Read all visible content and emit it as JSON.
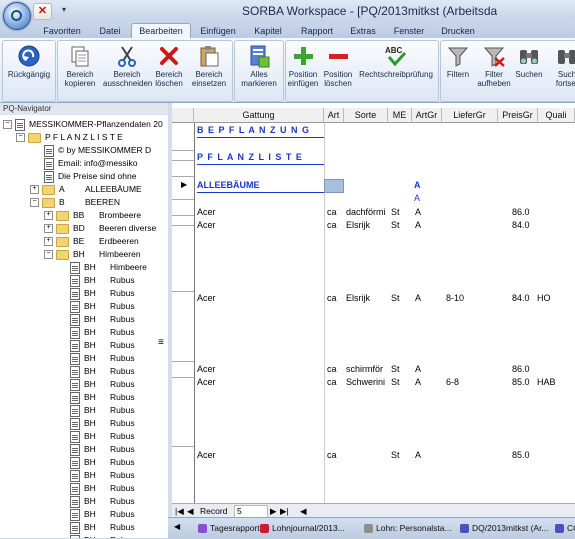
{
  "window": {
    "title": "SORBA Workspace - [PQ/2013mitkst (Arbeitsda",
    "close_glyph": "✕",
    "dropdown_glyph": "▾"
  },
  "tabs": [
    {
      "label": "Favoriten",
      "active": false
    },
    {
      "label": "Datei",
      "active": false
    },
    {
      "label": "Bearbeiten",
      "active": true
    },
    {
      "label": "Einfügen",
      "active": false
    },
    {
      "label": "Kapitel",
      "active": false
    },
    {
      "label": "Rapport",
      "active": false
    },
    {
      "label": "Extras",
      "active": false
    },
    {
      "label": "Fenster",
      "active": false
    },
    {
      "label": "Drucken",
      "active": false
    }
  ],
  "ribbon": {
    "undo": {
      "line1": "Rückgängig",
      "line2": "",
      "icon": "undo-icon"
    },
    "copy": {
      "line1": "Bereich",
      "line2": "kopieren",
      "icon": "copy-icon"
    },
    "cut": {
      "line1": "Bereich",
      "line2": "ausschneiden",
      "icon": "scissors-icon"
    },
    "delete": {
      "line1": "Bereich",
      "line2": "löschen",
      "icon": "delete-x-icon"
    },
    "paste": {
      "line1": "Bereich",
      "line2": "einsetzen",
      "icon": "paste-icon"
    },
    "select_all": {
      "line1": "Alles",
      "line2": "markieren",
      "icon": "select-all-icon"
    },
    "insert_pos": {
      "line1": "Position",
      "line2": "einfügen",
      "icon": "plus-icon"
    },
    "delete_pos": {
      "line1": "Position",
      "line2": "löschen",
      "icon": "minus-icon"
    },
    "spellcheck": {
      "line1": "Rechtschreibprüfung",
      "line2": "",
      "icon": "spellcheck-icon",
      "icon_text": "ABC"
    },
    "filter": {
      "line1": "Filtern",
      "line2": "",
      "icon": "funnel-icon"
    },
    "filter_off": {
      "line1": "Filter",
      "line2": "aufheben",
      "icon": "funnel-remove-icon"
    },
    "search": {
      "line1": "Suchen",
      "line2": "",
      "icon": "binoculars-icon"
    },
    "search_next": {
      "line1": "Such",
      "line2": "fortset",
      "icon": "binoculars-next-icon"
    }
  },
  "navigator": {
    "title": "PQ-Navigator",
    "root_label": "MESSIKOMMER-Pflanzendaten 20",
    "items": [
      {
        "type": "folder",
        "exp": "-",
        "code": "",
        "label": "P F L A N Z L I S T E"
      },
      {
        "type": "doc",
        "code": "",
        "label": "© by  MESSIKOMMER D"
      },
      {
        "type": "doc",
        "code": "",
        "label": "Email: info@messiko"
      },
      {
        "type": "doc",
        "code": "",
        "label": "Die Preise sind ohne"
      },
      {
        "type": "folder",
        "exp": "+",
        "code": "A",
        "label": "ALLEEBÄUME"
      },
      {
        "type": "folder",
        "exp": "-",
        "code": "B",
        "label": "BEEREN"
      },
      {
        "type": "folder",
        "exp": "+",
        "code": "BB",
        "label": "Brombeere"
      },
      {
        "type": "folder",
        "exp": "+",
        "code": "BD",
        "label": "Beeren diverse"
      },
      {
        "type": "folder",
        "exp": "+",
        "code": "BE",
        "label": "Erdbeeren"
      },
      {
        "type": "folder",
        "exp": "-",
        "code": "BH",
        "label": "Himbeeren"
      },
      {
        "type": "doc",
        "code": "BH",
        "label": "Himbeere"
      },
      {
        "type": "doc",
        "code": "BH",
        "label": "Rubus"
      },
      {
        "type": "doc",
        "code": "BH",
        "label": "Rubus"
      },
      {
        "type": "doc",
        "code": "BH",
        "label": "Rubus"
      },
      {
        "type": "doc",
        "code": "BH",
        "label": "Rubus"
      },
      {
        "type": "doc",
        "code": "BH",
        "label": "Rubus"
      },
      {
        "type": "doc",
        "code": "BH",
        "label": "Rubus"
      },
      {
        "type": "doc",
        "code": "BH",
        "label": "Rubus"
      },
      {
        "type": "doc",
        "code": "BH",
        "label": "Rubus"
      },
      {
        "type": "doc",
        "code": "BH",
        "label": "Rubus"
      },
      {
        "type": "doc",
        "code": "BH",
        "label": "Rubus"
      },
      {
        "type": "doc",
        "code": "BH",
        "label": "Rubus"
      },
      {
        "type": "doc",
        "code": "BH",
        "label": "Rubus"
      },
      {
        "type": "doc",
        "code": "BH",
        "label": "Rubus"
      },
      {
        "type": "doc",
        "code": "BH",
        "label": "Rubus"
      },
      {
        "type": "doc",
        "code": "BH",
        "label": "Rubus"
      },
      {
        "type": "doc",
        "code": "BH",
        "label": "Rubus"
      },
      {
        "type": "doc",
        "code": "BH",
        "label": "Rubus"
      },
      {
        "type": "doc",
        "code": "BH",
        "label": "Rubus"
      },
      {
        "type": "doc",
        "code": "BH",
        "label": "Rubus"
      },
      {
        "type": "doc",
        "code": "BH",
        "label": "Rubus"
      },
      {
        "type": "doc",
        "code": "BH",
        "label": "Rubus"
      }
    ]
  },
  "grid": {
    "columns": [
      "Gattung",
      "Art",
      "Sorte",
      "ME",
      "ArtGr",
      "LieferGr",
      "PreisGr",
      "Quali"
    ],
    "headings": {
      "bepflanzung": "B E P F L A N Z U N G",
      "pflanzliste": "P F L A N Z L I S T E",
      "alleebaeume": "ALLEEBÄUME",
      "artgr_a": "A",
      "artgr_a2": "A",
      "row_marker": "▶"
    },
    "rows": [
      {
        "gattung": "Acer",
        "art": "ca",
        "sorte": "dachförmi",
        "me": "St",
        "artgr": "A",
        "liefergr": "",
        "preisgr": "86.0",
        "quali": ""
      },
      {
        "gattung": "Acer",
        "art": "ca",
        "sorte": "Elsrijk",
        "me": "St",
        "artgr": "A",
        "liefergr": "",
        "preisgr": "84.0",
        "quali": ""
      },
      {
        "gattung": "Acer",
        "art": "ca",
        "sorte": "Elsrijk",
        "me": "St",
        "artgr": "A",
        "liefergr": "8-10",
        "preisgr": "84.0",
        "quali": "HO"
      },
      {
        "gattung": "Acer",
        "art": "ca",
        "sorte": "schirmför",
        "me": "St",
        "artgr": "A",
        "liefergr": "",
        "preisgr": "86.0",
        "quali": ""
      },
      {
        "gattung": "Acer",
        "art": "ca",
        "sorte": "Schwerini",
        "me": "St",
        "artgr": "A",
        "liefergr": "6-8",
        "preisgr": "85.0",
        "quali": "HAB"
      },
      {
        "gattung": "Acer",
        "art": "ca",
        "sorte": "",
        "me": "St",
        "artgr": "A",
        "liefergr": "",
        "preisgr": "85.0",
        "quali": ""
      }
    ]
  },
  "recnav": {
    "first": "|◀",
    "prev": "◀",
    "label": "Record",
    "value": "5",
    "next": "▶",
    "last": "▶|",
    "scroll_left": "◀"
  },
  "taskbar": {
    "scroll_left": "◀",
    "items": [
      {
        "label": "Tagesrapport",
        "color": "#8a4fd0"
      },
      {
        "label": "Lohnjournal/2013...",
        "color": "#c8202a"
      },
      {
        "label": "Lohn: Personalsta...",
        "color": "#8d8d8d"
      },
      {
        "label": "DQ/2013mitkst (Ar...",
        "color": "#4b4fbf"
      },
      {
        "label": "CQ",
        "color": "#4b4fbf"
      }
    ]
  }
}
